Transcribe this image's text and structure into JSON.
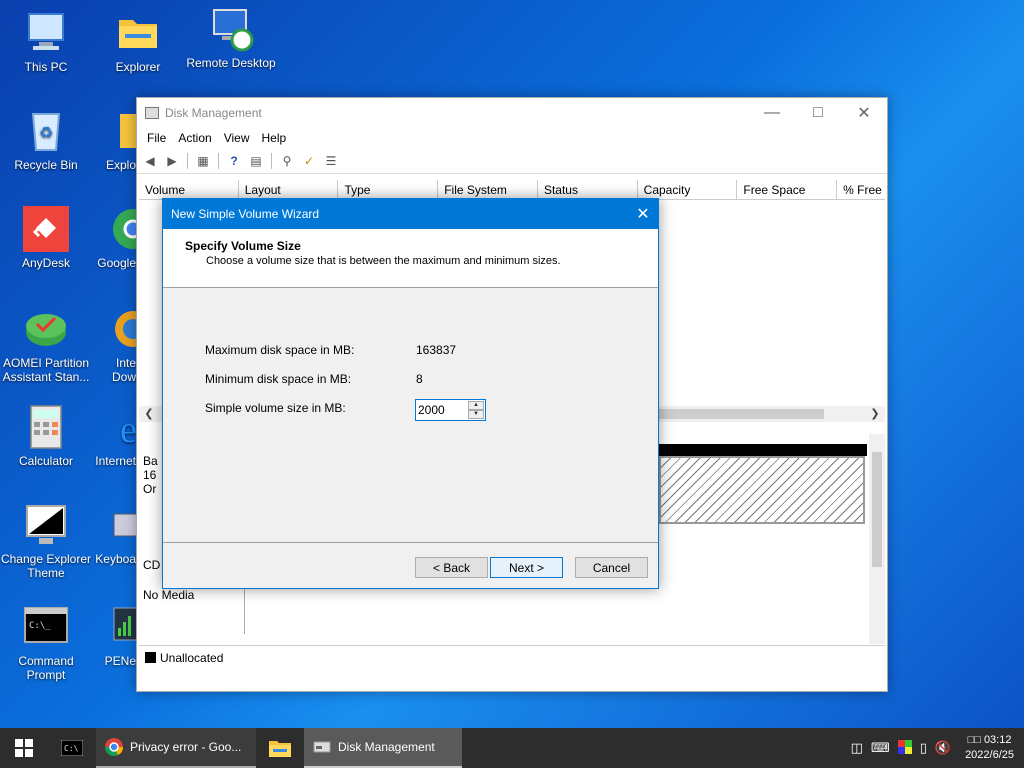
{
  "desktop": {
    "icons": [
      {
        "label": "This PC"
      },
      {
        "label": "Explorer"
      },
      {
        "label": "Remote Desktop"
      },
      {
        "label": "Recycle Bin"
      },
      {
        "label": "Explo"
      },
      {
        "label": "AnyDesk"
      },
      {
        "label": "Google"
      },
      {
        "label": "AOMEI Partition Assistant Stan..."
      },
      {
        "label": "Inte Dow"
      },
      {
        "label": "Calculator"
      },
      {
        "label": "Internet"
      },
      {
        "label": "Change Explorer Theme"
      },
      {
        "label": "Keyboa"
      },
      {
        "label": "Command Prompt"
      },
      {
        "label": "PENe"
      }
    ]
  },
  "window": {
    "title": "Disk Management",
    "menu": [
      "File",
      "Action",
      "View",
      "Help"
    ],
    "columns": [
      "Volume",
      "Layout",
      "Type",
      "File System",
      "Status",
      "Capacity",
      "Free Space",
      "% Free"
    ],
    "disk0": {
      "line1": "Ba",
      "line2": "16",
      "line3": "Or"
    },
    "cdrom": {
      "label": "CD",
      "media": "No Media"
    },
    "legend": "Unallocated"
  },
  "wizard": {
    "title": "New Simple Volume Wizard",
    "heading": "Specify Volume Size",
    "subheading": "Choose a volume size that is between the maximum and minimum sizes.",
    "max_label": "Maximum disk space in MB:",
    "max_value": "163837",
    "min_label": "Minimum disk space in MB:",
    "min_value": "8",
    "size_label": "Simple volume size in MB:",
    "size_value": "2000",
    "back": "< Back",
    "next": "Next >",
    "cancel": "Cancel"
  },
  "taskbar": {
    "chrome_label": "Privacy error - Goo...",
    "diskmgmt_label": "Disk Management",
    "time": "03:12",
    "time_prefix": "□□",
    "date": "2022/6/25"
  }
}
